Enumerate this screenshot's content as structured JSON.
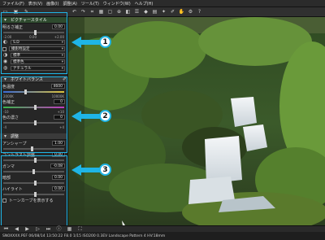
{
  "menubar": {
    "items": [
      "ファイル(F)",
      "表示(V)",
      "画像(I)",
      "調整(A)",
      "ツール(T)",
      "ウィンドウ(W)",
      "ヘルプ(H)"
    ]
  },
  "toolbar": {
    "left_icons": [
      "folder-icon",
      "image-icon",
      "pen-icon"
    ],
    "icons": [
      "rotate-left-icon",
      "rotate-right-icon",
      "crop-icon",
      "grid-icon",
      "fit-icon",
      "zoom-icon",
      "compare-icon",
      "list-icon",
      "tag-icon",
      "save-icon",
      "star-icon",
      "eyedropper-icon",
      "hand-icon",
      "gear-icon",
      "help-icon"
    ]
  },
  "panel1": {
    "title": "ピクチャースタイル",
    "exposure_label": "明るさ補正",
    "exposure_value": "0.00",
    "exposure_ticks": [
      "-2.00",
      "0.00",
      "+2.00"
    ],
    "picture_style_value": "S.D",
    "row1_value": "撮影時設定",
    "row2_value": "標準",
    "row3_value": "標準色",
    "row4_value": "ナチュラル"
  },
  "panel2": {
    "title": "ホワイトバランス",
    "temp_label": "色温度",
    "temp_value": "4600",
    "temp_ticks": [
      "2000K",
      "10000K"
    ],
    "tint_label": "色補正",
    "tint_value": "0",
    "tint_ticks": [
      "-10",
      "+10"
    ],
    "sat_label": "色の濃さ",
    "sat_value": "0",
    "sat_ticks": [
      "-4",
      "+4"
    ]
  },
  "panel3": {
    "title": "調整",
    "sharp_label": "アンシャープ",
    "sharp_value": "1.00",
    "contrast_label": "コントラスト調整",
    "contrast_value": "0.00",
    "gamma_label": "ガンマ",
    "gamma_value": "-0.08",
    "shadow_label": "暗部",
    "shadow_value": "0.00",
    "highlight_label": "ハイライト",
    "highlight_value": "0.00",
    "checkbox_label": "トーンカーブを表示する"
  },
  "callouts": [
    "1",
    "2",
    "3"
  ],
  "status": {
    "text": "SN0XXXX.PEF 06/08/14 13:50:22 F8.0 1/15 ISO200 0.3EV Landscape Pattern 4 HV:18mm"
  },
  "bottom_icons": [
    "first-icon",
    "prev-icon",
    "play-icon",
    "next-icon",
    "last-icon",
    "info-icon",
    "grid-view-icon",
    "fullscreen-icon"
  ]
}
